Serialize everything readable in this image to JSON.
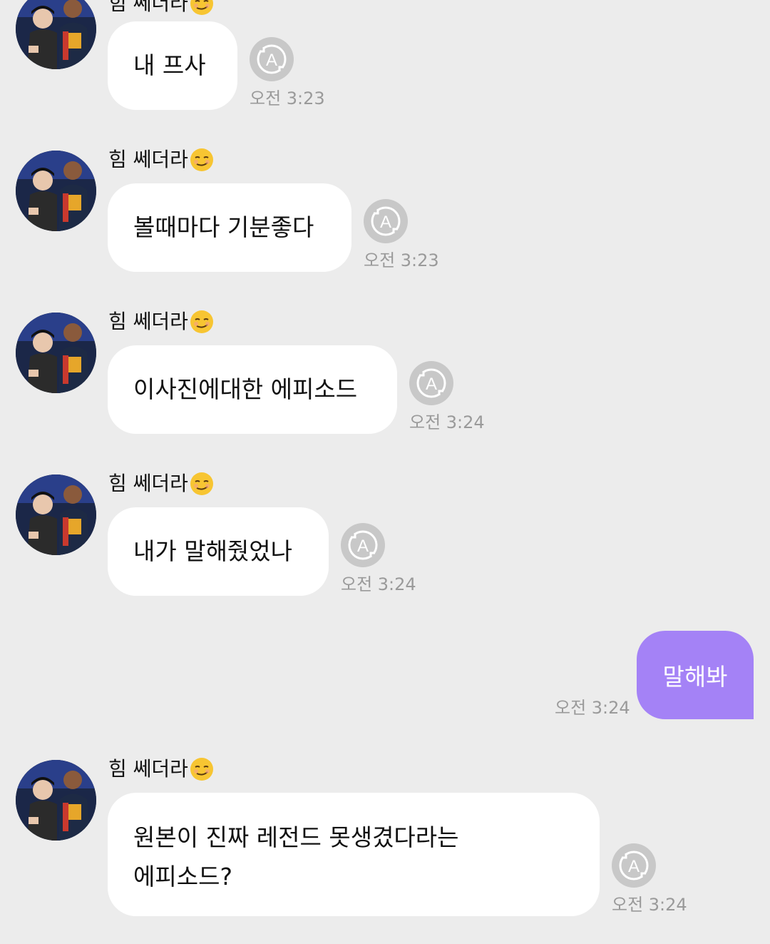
{
  "messages": [
    {
      "sender": "힘 쎄더라",
      "text": "내 프사",
      "time": "오전 3:23"
    },
    {
      "sender": "힘 쎄더라",
      "text": "볼때마다 기분좋다",
      "time": "오전 3:23"
    },
    {
      "sender": "힘 쎄더라",
      "text": "이사진에대한 에피소드",
      "time": "오전 3:24"
    },
    {
      "sender": "힘 쎄더라",
      "text": "내가 말해줬었나",
      "time": "오전 3:24"
    },
    {
      "sender": "힘 쎄더라",
      "lines": [
        "원본이 진짜 레전드 못생겼다라는",
        "에피소드?"
      ],
      "time": "오전 3:24"
    }
  ],
  "my_message": {
    "text": "말해봐",
    "time": "오전 3:24"
  },
  "colors": {
    "background": "#ececec",
    "incoming_bubble": "#ffffff",
    "outgoing_bubble": "#a482f6",
    "timestamp": "#9a9a9a",
    "translate_button": "#c8c8c8"
  },
  "icons": {
    "sender_emoji": "smirking-face-icon",
    "translate": "auto-translate-icon",
    "avatar": "profile-photo"
  }
}
